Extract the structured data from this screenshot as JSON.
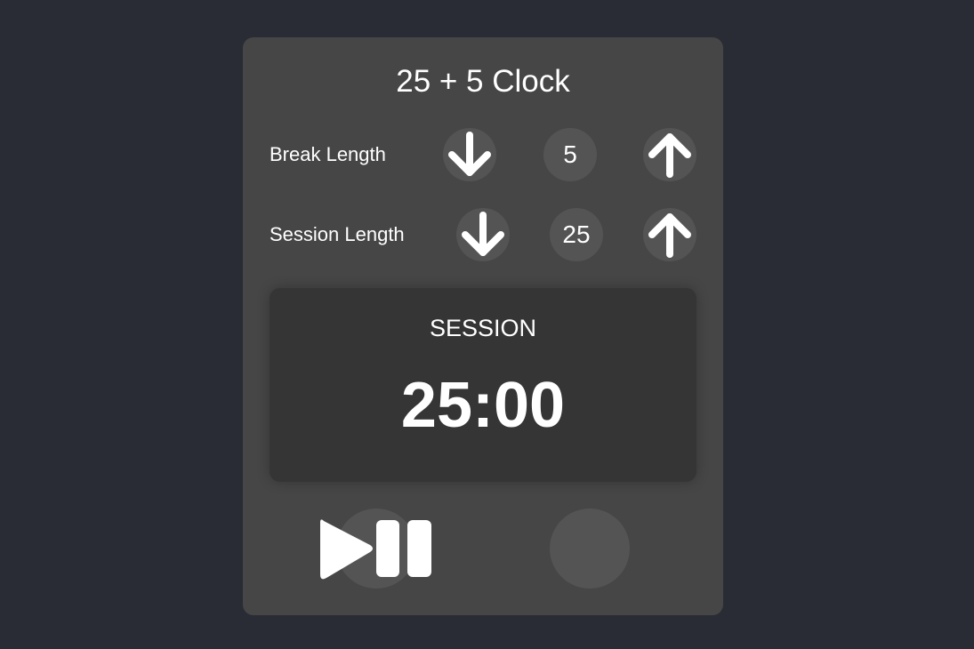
{
  "app": {
    "title": "25 + 5 Clock"
  },
  "break": {
    "label": "Break Length",
    "value": "5",
    "decrement_icon": "arrow-down-icon",
    "increment_icon": "arrow-up-icon"
  },
  "session": {
    "label": "Session Length",
    "value": "25",
    "decrement_icon": "arrow-down-icon",
    "increment_icon": "arrow-up-icon"
  },
  "timer": {
    "label": "SESSION",
    "time_left": "25:00"
  },
  "controls": {
    "start_stop_icon": "play-pause-icon",
    "reset_icon": "reset-icon"
  },
  "colors": {
    "page_background": "#292c34",
    "card_background": "#464646",
    "button_background": "#545454",
    "timer_background": "#353535",
    "text": "#ffffff"
  }
}
